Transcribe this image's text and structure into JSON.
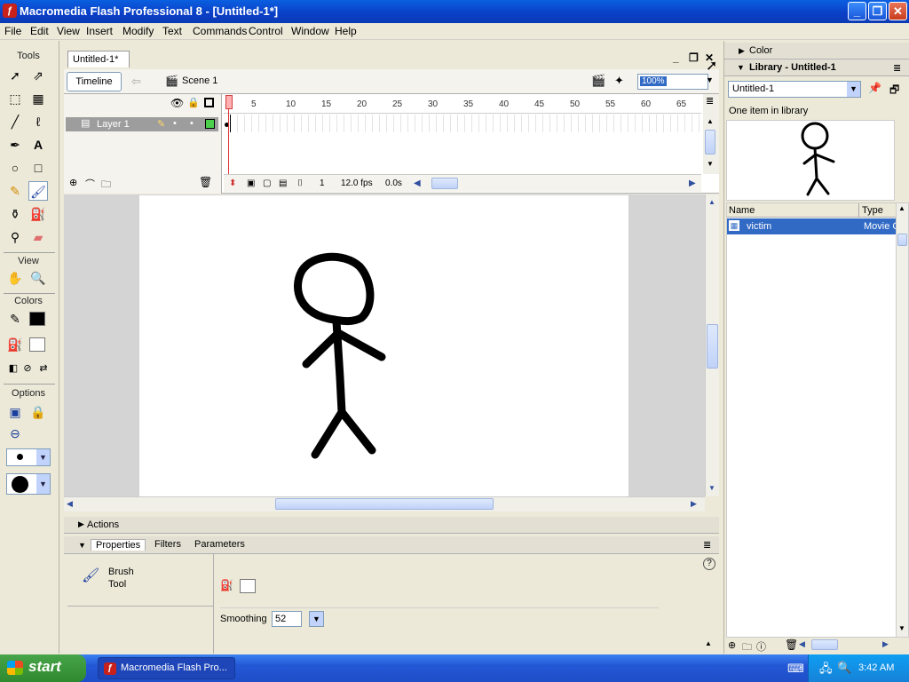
{
  "window": {
    "title": "Macromedia Flash Professional 8 - [Untitled-1*]"
  },
  "menu": [
    "File",
    "Edit",
    "View",
    "Insert",
    "Modify",
    "Text",
    "Commands",
    "Control",
    "Window",
    "Help"
  ],
  "tools": {
    "header": "Tools",
    "view_label": "View",
    "colors_label": "Colors",
    "options_label": "Options",
    "selected_tool": "brush",
    "stroke_color": "#000000",
    "fill_color": "#ffffff"
  },
  "document": {
    "tab_label": "Untitled-1*",
    "timeline_button": "Timeline",
    "scene": "Scene 1",
    "zoom": "100%"
  },
  "timeline": {
    "layer_name": "Layer 1",
    "frame_numbers": [
      "1",
      "5",
      "10",
      "15",
      "20",
      "25",
      "30",
      "35",
      "40",
      "45",
      "50",
      "55",
      "60",
      "65"
    ],
    "current_frame": "1",
    "fps": "12.0 fps",
    "time": "0.0s"
  },
  "panels": {
    "actions": "Actions",
    "tabs": [
      "Properties",
      "Filters",
      "Parameters"
    ],
    "tool_name_line1": "Brush",
    "tool_name_line2": "Tool",
    "smoothing_label": "Smoothing",
    "smoothing_value": "52"
  },
  "library": {
    "color_header": "Color",
    "header": "Library - Untitled-1",
    "selected_doc": "Untitled-1",
    "count_text": "One item in library",
    "col_name": "Name",
    "col_type": "Type",
    "items": [
      {
        "name": "victim",
        "type": "Movie C"
      }
    ]
  },
  "taskbar": {
    "start": "start",
    "task": "Macromedia Flash Pro...",
    "clock": "3:42 AM"
  },
  "colors": {
    "titlebar": "#0a3ec6",
    "selection": "#316ac5",
    "start_green": "#2f8a2f"
  }
}
